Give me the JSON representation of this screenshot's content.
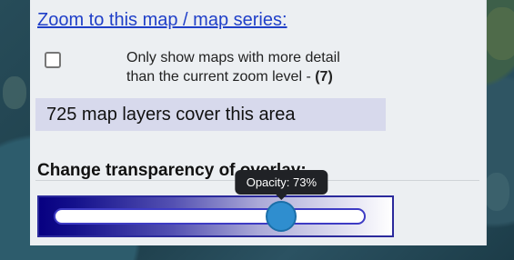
{
  "panel": {
    "zoom_link": "Zoom to this map / map series:",
    "filter": {
      "line1": "Only show maps with more detail",
      "line2_prefix": "than the current zoom level - ",
      "count": "(7)",
      "checked": false
    },
    "layer_count_text": "725 map layers cover this area",
    "opacity": {
      "heading": "Change transparency of overlay:",
      "label": "Opacity:",
      "value_text": "73%",
      "value": 0.73
    }
  },
  "colors": {
    "link": "#1f3fc8",
    "thumb": "#2f8ecf",
    "gradient_start": "#070081",
    "gradient_end": "#ffffff",
    "tooltip_bg": "#202226"
  },
  "icons": {
    "checkbox": "checkbox-unchecked-icon"
  }
}
